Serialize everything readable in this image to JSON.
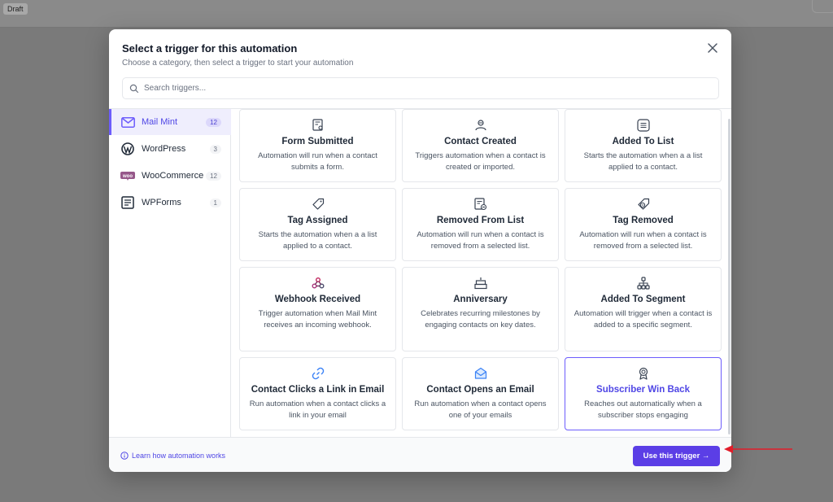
{
  "background": {
    "draft_label": "Draft"
  },
  "modal": {
    "title": "Select a trigger for this automation",
    "subtitle": "Choose a category, then select a trigger to start your automation",
    "close_icon": "close-icon"
  },
  "search": {
    "placeholder": "Search triggers...",
    "value": ""
  },
  "categories": [
    {
      "label": "Mail Mint",
      "count": "12",
      "icon": "mail-mint-icon",
      "active": true
    },
    {
      "label": "WordPress",
      "count": "3",
      "icon": "wordpress-icon",
      "active": false
    },
    {
      "label": "WooCommerce",
      "count": "12",
      "icon": "woocommerce-icon",
      "active": false
    },
    {
      "label": "WPForms",
      "count": "1",
      "icon": "wpforms-icon",
      "active": false
    }
  ],
  "triggers": [
    {
      "title": "Form Submitted",
      "desc": "Automation will run when a contact submits a form.",
      "icon": "form-icon"
    },
    {
      "title": "Contact Created",
      "desc": "Triggers automation when a contact is created or imported.",
      "icon": "contact-icon"
    },
    {
      "title": "Added To List",
      "desc": "Starts the automation when a a list applied to a contact.",
      "icon": "list-icon"
    },
    {
      "title": "Tag Assigned",
      "desc": "Starts the automation when a a list applied to a contact.",
      "icon": "tag-icon"
    },
    {
      "title": "Removed From List",
      "desc": "Automation will run when a contact is removed from a selected list.",
      "icon": "list-remove-icon"
    },
    {
      "title": "Tag Removed",
      "desc": "Automation will run when a contact is removed from a selected list.",
      "icon": "tag-remove-icon"
    },
    {
      "title": "Webhook Received",
      "desc": "Trigger automation when Mail Mint receives an incoming webhook.",
      "icon": "webhook-icon"
    },
    {
      "title": "Anniversary",
      "desc": "Celebrates recurring milestones by engaging contacts on key dates.",
      "icon": "cake-icon"
    },
    {
      "title": "Added To Segment",
      "desc": "Automation will trigger when a contact is added to a specific segment.",
      "icon": "segment-icon"
    },
    {
      "title": "Contact Clicks a Link in Email",
      "desc": "Run automation when a contact clicks a link in your email",
      "icon": "link-icon"
    },
    {
      "title": "Contact Opens an Email",
      "desc": "Run automation when a contact opens one of your emails",
      "icon": "email-open-icon"
    },
    {
      "title": "Subscriber Win Back",
      "desc": "Reaches out automatically when a subscriber stops engaging",
      "icon": "award-icon",
      "selected": true
    }
  ],
  "footer": {
    "learn_link": "Learn how automation works",
    "use_button": "Use this trigger →"
  },
  "colors": {
    "accent": "#5b3ee6",
    "active_bg": "#efeefd",
    "annotation_arrow": "#e11d2a"
  }
}
